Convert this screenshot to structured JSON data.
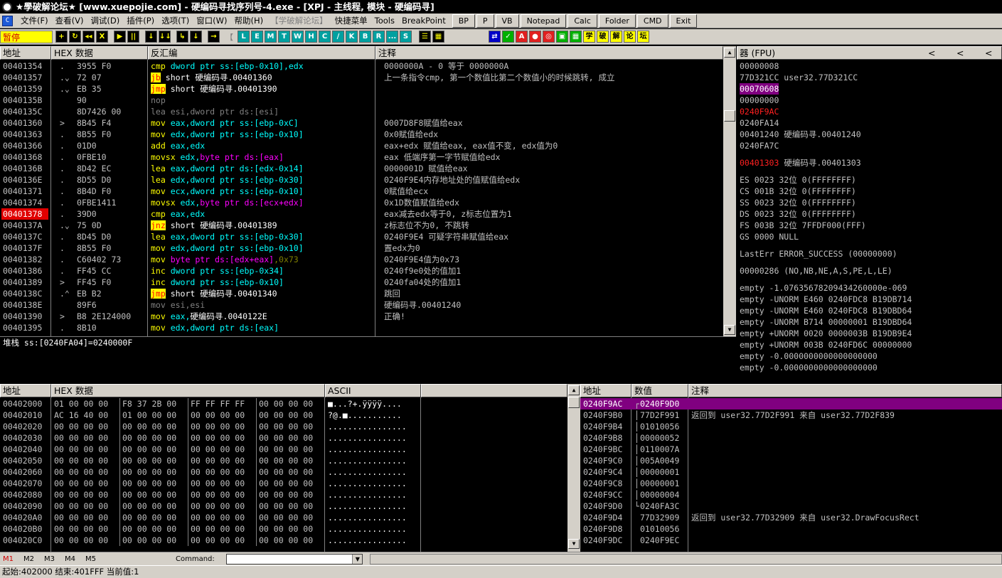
{
  "window": {
    "title": "★學破解论坛★ [www.xuepojie.com]  - 硬编码寻找序列号-4.exe - [XPJ - 主线程, 模块 - 硬编码寻]"
  },
  "menu": {
    "items": [
      "文件(F)",
      "查看(V)",
      "调试(D)",
      "插件(P)",
      "选项(T)",
      "窗口(W)",
      "帮助(H)"
    ],
    "disabled_item": "【学破解论坛】",
    "extra_items": [
      "快捷菜单",
      "Tools",
      "BreakPoint"
    ],
    "buttons": [
      "BP",
      "P",
      "VB",
      "Notepad",
      "Calc",
      "Folder",
      "CMD",
      "Exit"
    ]
  },
  "toolbar": {
    "status": "暂停",
    "btns1": [
      "+",
      "↻",
      "◂◂",
      "X",
      "▶",
      "||",
      "↓",
      "↓↓",
      "↳",
      "↓",
      "→"
    ],
    "bracket": "【",
    "letters": [
      "L",
      "E",
      "M",
      "T",
      "W",
      "H",
      "C",
      "/",
      "K",
      "B",
      "R",
      "...",
      "S"
    ],
    "grid": [
      "☰",
      "▦"
    ],
    "right": [
      "⇄",
      "✓",
      "A",
      "●",
      "◎",
      "▣",
      "▦",
      "学",
      "破",
      "解",
      "论",
      "坛"
    ]
  },
  "cpu": {
    "headers": {
      "addr": "地址",
      "hex": "HEX 数据",
      "disasm": "反汇编",
      "comment": "注释"
    },
    "rows": [
      {
        "addr": "00401354",
        "mark": ".",
        "hex": "3955 F0",
        "parts": [
          [
            "cmp",
            "y"
          ],
          [
            " dword ptr ss:[ebp-0x10]",
            "c"
          ],
          [
            ",edx",
            "c"
          ]
        ],
        "comment": "0000000A - 0 等于  0000000A"
      },
      {
        "addr": "00401357",
        "mark": ".v",
        "hex": "72 07",
        "parts": [
          [
            "jb",
            "jmp"
          ],
          [
            " short 硬编码寻.00401360",
            "w"
          ]
        ],
        "comment": "上一条指令cmp, 第一个数值比第二个数值小的时候跳转, 成立"
      },
      {
        "addr": "00401359",
        "mark": ".v",
        "hex": "EB 35",
        "parts": [
          [
            "jmp",
            "jmp"
          ],
          [
            " short 硬编码寻.00401390",
            "w"
          ]
        ],
        "comment": ""
      },
      {
        "addr": "0040135B",
        "mark": "",
        "hex": "90",
        "parts": [
          [
            "nop",
            "g"
          ]
        ],
        "comment": ""
      },
      {
        "addr": "0040135C",
        "mark": "",
        "hex": "8D7426 00",
        "parts": [
          [
            "lea esi,dword ptr ds:[esi]",
            "g"
          ]
        ],
        "comment": ""
      },
      {
        "addr": "00401360",
        "mark": ">",
        "hex": "8B45 F4",
        "parts": [
          [
            "mov",
            "y"
          ],
          [
            " eax,",
            "c"
          ],
          [
            "dword ptr ss:[ebp-0xC]",
            "c"
          ]
        ],
        "comment": "0007D8F8赋值给eax"
      },
      {
        "addr": "00401363",
        "mark": ".",
        "hex": "8B55 F0",
        "parts": [
          [
            "mov",
            "y"
          ],
          [
            " edx,",
            "c"
          ],
          [
            "dword ptr ss:[ebp-0x10]",
            "c"
          ]
        ],
        "comment": "0x0赋值给edx"
      },
      {
        "addr": "00401366",
        "mark": ".",
        "hex": "01D0",
        "parts": [
          [
            "add",
            "y"
          ],
          [
            " eax,edx",
            "c"
          ]
        ],
        "comment": "eax+edx 赋值给eax, eax值不变, edx值为0"
      },
      {
        "addr": "00401368",
        "mark": ".",
        "hex": "0FBE10",
        "parts": [
          [
            "movsx",
            "y"
          ],
          [
            " edx,",
            "c"
          ],
          [
            "byte ptr ds:[eax]",
            "m"
          ]
        ],
        "comment": "eax 低端序第一字节赋值给edx"
      },
      {
        "addr": "0040136B",
        "mark": ".",
        "hex": "8D42 EC",
        "parts": [
          [
            "lea",
            "y"
          ],
          [
            " eax,",
            "c"
          ],
          [
            "dword ptr ds:[edx-0x14]",
            "c"
          ]
        ],
        "comment": "0000001D 赋值给eax"
      },
      {
        "addr": "0040136E",
        "mark": ".",
        "hex": "8D55 D0",
        "parts": [
          [
            "lea",
            "y"
          ],
          [
            " edx,",
            "c"
          ],
          [
            "dword ptr ss:[ebp-0x30]",
            "c"
          ]
        ],
        "comment": "0240F9E4内存地址处的值赋值给edx"
      },
      {
        "addr": "00401371",
        "mark": ".",
        "hex": "8B4D F0",
        "parts": [
          [
            "mov",
            "y"
          ],
          [
            " ecx,",
            "c"
          ],
          [
            "dword ptr ss:[ebp-0x10]",
            "c"
          ]
        ],
        "comment": "0赋值给ecx"
      },
      {
        "addr": "00401374",
        "mark": ".",
        "hex": "0FBE1411",
        "parts": [
          [
            "movsx",
            "y"
          ],
          [
            " edx,",
            "c"
          ],
          [
            "byte ptr ds:[ecx+edx]",
            "m"
          ]
        ],
        "comment": "0x1D数值赋值给edx"
      },
      {
        "addr": "00401378",
        "mark": ".",
        "hex": "39D0",
        "parts": [
          [
            "cmp",
            "y"
          ],
          [
            " eax,edx",
            "c"
          ]
        ],
        "comment": "eax减去edx等于0, z标志位置为1",
        "hl": true
      },
      {
        "addr": "0040137A",
        "mark": ".v",
        "hex": "75 0D",
        "parts": [
          [
            "jnz",
            "jmp"
          ],
          [
            " short 硬编码寻.00401389",
            "w"
          ]
        ],
        "comment": "z标志位不为0, 不跳转"
      },
      {
        "addr": "0040137C",
        "mark": ".",
        "hex": "8D45 D0",
        "parts": [
          [
            "lea",
            "y"
          ],
          [
            " eax,",
            "c"
          ],
          [
            "dword ptr ss:[ebp-0x30]",
            "c"
          ]
        ],
        "comment": "0240F9E4 可疑字符串赋值给eax"
      },
      {
        "addr": "0040137F",
        "mark": ".",
        "hex": "8B55 F0",
        "parts": [
          [
            "mov",
            "y"
          ],
          [
            " edx,",
            "c"
          ],
          [
            "dword ptr ss:[ebp-0x10]",
            "c"
          ]
        ],
        "comment": "置edx为0"
      },
      {
        "addr": "00401382",
        "mark": ".",
        "hex": "C60402 73",
        "parts": [
          [
            "mov",
            "y"
          ],
          [
            " byte ptr ds:[edx+eax]",
            "m"
          ],
          [
            ",0x73",
            "dy"
          ]
        ],
        "comment": "0240F9E4值为0x73"
      },
      {
        "addr": "00401386",
        "mark": ".",
        "hex": "FF45 CC",
        "parts": [
          [
            "inc",
            "y"
          ],
          [
            " dword ptr ss:[ebp-0x34]",
            "c"
          ]
        ],
        "comment": "0240f9e0处的值加1"
      },
      {
        "addr": "00401389",
        "mark": ">",
        "hex": "FF45 F0",
        "parts": [
          [
            "inc",
            "y"
          ],
          [
            " dword ptr ss:[ebp-0x10]",
            "c"
          ]
        ],
        "comment": "0240fa04处的值加1"
      },
      {
        "addr": "0040138C",
        "mark": ".^",
        "hex": "EB B2",
        "parts": [
          [
            "jmp",
            "jmp"
          ],
          [
            " short 硬编码寻.00401340",
            "w"
          ]
        ],
        "comment": "跳回"
      },
      {
        "addr": "0040138E",
        "mark": "",
        "hex": "89F6",
        "parts": [
          [
            "mov esi,esi",
            "g"
          ]
        ],
        "comment": "硬编码寻.00401240"
      },
      {
        "addr": "00401390",
        "mark": ">",
        "hex": "B8 2E124000",
        "parts": [
          [
            "mov",
            "y"
          ],
          [
            " eax,",
            "c"
          ],
          [
            "硬编码寻.0040122E",
            "w"
          ]
        ],
        "comment": "正确!"
      },
      {
        "addr": "00401395",
        "mark": ".",
        "hex": "8B10",
        "parts": [
          [
            "mov",
            "y"
          ],
          [
            " edx,",
            "c"
          ],
          [
            "dword ptr ds:[eax]",
            "c"
          ]
        ],
        "comment": ""
      }
    ]
  },
  "info": {
    "text": "堆栈 ss:[0240FA04]=0240000F"
  },
  "registers": {
    "header": "器 (FPU)",
    "arrows": [
      "<",
      "<",
      "<"
    ],
    "lines": [
      {
        "t": "00000008",
        "cls": ""
      },
      {
        "t": "77D321CC user32.77D321CC",
        "cls": ""
      },
      {
        "t": "00070608",
        "cls": "sel2"
      },
      {
        "t": "00000000",
        "cls": ""
      },
      {
        "t": "0240F9AC",
        "cls": "redtxt"
      },
      {
        "t": "0240FA14",
        "cls": ""
      },
      {
        "t": "00401240 硬编码寻.00401240",
        "cls": ""
      },
      {
        "t": "0240FA7C",
        "cls": ""
      },
      {
        "t": "",
        "cls": ""
      },
      {
        "t": "00401303 硬编码寻.00401303",
        "cls": "eipline"
      },
      {
        "t": "",
        "cls": ""
      },
      {
        "t": " ES 0023 32位 0(FFFFFFFF)",
        "cls": ""
      },
      {
        "t": " CS 001B 32位 0(FFFFFFFF)",
        "cls": ""
      },
      {
        "t": " SS 0023 32位 0(FFFFFFFF)",
        "cls": ""
      },
      {
        "t": " DS 0023 32位 0(FFFFFFFF)",
        "cls": ""
      },
      {
        "t": " FS 003B 32位 7FFDF000(FFF)",
        "cls": ""
      },
      {
        "t": " GS 0000 NULL",
        "cls": ""
      },
      {
        "t": "",
        "cls": ""
      },
      {
        "t": " LastErr ERROR_SUCCESS (00000000)",
        "cls": ""
      },
      {
        "t": "",
        "cls": ""
      },
      {
        "t": "00000286 (NO,NB,NE,A,S,PE,L,LE)",
        "cls": ""
      },
      {
        "t": "",
        "cls": ""
      },
      {
        "t": "empty -1.07635678209434260000e-069",
        "cls": ""
      },
      {
        "t": "empty -UNORM E460 0240FDC8 B19DB714",
        "cls": ""
      },
      {
        "t": "empty -UNORM E460 0240FDC8 B19DBD64",
        "cls": ""
      },
      {
        "t": "empty -UNORM B714 00000001 B19DBD64",
        "cls": ""
      },
      {
        "t": "empty +UNORM 0020 0000003B B19DB9E4",
        "cls": ""
      },
      {
        "t": "empty +UNORM 003B 0240FD6C 00000000",
        "cls": ""
      },
      {
        "t": "empty -0.0000000000000000000",
        "cls": ""
      },
      {
        "t": "empty -0.0000000000000000000",
        "cls": ""
      }
    ]
  },
  "dump": {
    "headers": {
      "addr": "地址",
      "hex": "HEX 数据",
      "ascii": "ASCII"
    },
    "rows": [
      {
        "addr": "00402000",
        "hex": "01 00 00 00|F8 37 2B 00|FF FF FF FF|00 00 00 00",
        "ascii": "■...?+.ÿÿÿÿ...."
      },
      {
        "addr": "00402010",
        "hex": "AC 16 40 00|01 00 00 00|00 00 00 00|00 00 00 00",
        "ascii": "?@.■..........."
      },
      {
        "addr": "00402020",
        "hex": "00 00 00 00|00 00 00 00|00 00 00 00|00 00 00 00",
        "ascii": "................"
      },
      {
        "addr": "00402030",
        "hex": "00 00 00 00|00 00 00 00|00 00 00 00|00 00 00 00",
        "ascii": "................"
      },
      {
        "addr": "00402040",
        "hex": "00 00 00 00|00 00 00 00|00 00 00 00|00 00 00 00",
        "ascii": "................"
      },
      {
        "addr": "00402050",
        "hex": "00 00 00 00|00 00 00 00|00 00 00 00|00 00 00 00",
        "ascii": "................"
      },
      {
        "addr": "00402060",
        "hex": "00 00 00 00|00 00 00 00|00 00 00 00|00 00 00 00",
        "ascii": "................"
      },
      {
        "addr": "00402070",
        "hex": "00 00 00 00|00 00 00 00|00 00 00 00|00 00 00 00",
        "ascii": "................"
      },
      {
        "addr": "00402080",
        "hex": "00 00 00 00|00 00 00 00|00 00 00 00|00 00 00 00",
        "ascii": "................"
      },
      {
        "addr": "00402090",
        "hex": "00 00 00 00|00 00 00 00|00 00 00 00|00 00 00 00",
        "ascii": "................"
      },
      {
        "addr": "004020A0",
        "hex": "00 00 00 00|00 00 00 00|00 00 00 00|00 00 00 00",
        "ascii": "................"
      },
      {
        "addr": "004020B0",
        "hex": "00 00 00 00|00 00 00 00|00 00 00 00|00 00 00 00",
        "ascii": "................"
      },
      {
        "addr": "004020C0",
        "hex": "00 00 00 00|00 00 00 00|00 00 00 00|00 00 00 00",
        "ascii": "................"
      }
    ]
  },
  "stack": {
    "headers": {
      "addr": "地址",
      "value": "数值",
      "comment": "注释"
    },
    "rows": [
      {
        "addr": "0240F9AC",
        "bracket": "┌",
        "value": "0240F9D0",
        "comment": "",
        "sel": true
      },
      {
        "addr": "0240F9B0",
        "bracket": "│",
        "value": "77D2F991",
        "comment": "返回到 user32.77D2F991 来自 user32.77D2F839"
      },
      {
        "addr": "0240F9B4",
        "bracket": "│",
        "value": "01010056",
        "comment": ""
      },
      {
        "addr": "0240F9B8",
        "bracket": "│",
        "value": "00000052",
        "comment": ""
      },
      {
        "addr": "0240F9BC",
        "bracket": "│",
        "value": "0110007A",
        "comment": ""
      },
      {
        "addr": "0240F9C0",
        "bracket": "│",
        "value": "005A0049",
        "comment": ""
      },
      {
        "addr": "0240F9C4",
        "bracket": "│",
        "value": "00000001",
        "comment": ""
      },
      {
        "addr": "0240F9C8",
        "bracket": "│",
        "value": "00000001",
        "comment": ""
      },
      {
        "addr": "0240F9CC",
        "bracket": "│",
        "value": "00000004",
        "comment": ""
      },
      {
        "addr": "0240F9D0",
        "bracket": "└",
        "value": "0240FA3C",
        "comment": ""
      },
      {
        "addr": "0240F9D4",
        "bracket": " ",
        "value": "77D32909",
        "comment": "返回到 user32.77D32909 来自 user32.DrawFocusRect"
      },
      {
        "addr": "0240F9D8",
        "bracket": " ",
        "value": "01010056",
        "comment": ""
      },
      {
        "addr": "0240F9DC",
        "bracket": " ",
        "value": "0240F9EC",
        "comment": ""
      }
    ]
  },
  "bottom": {
    "tabs": [
      "M1",
      "M2",
      "M3",
      "M4",
      "M5"
    ],
    "command_label": "Command:",
    "command_value": ""
  },
  "status": {
    "text": "起始:402000 结束:401FFF 当前值:1"
  }
}
